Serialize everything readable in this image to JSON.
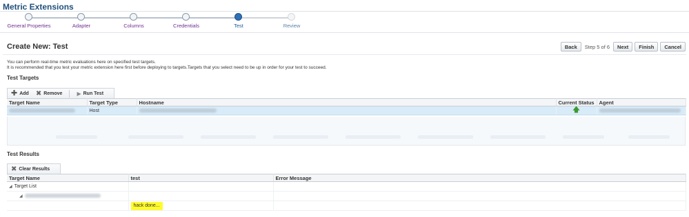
{
  "page": {
    "title": "Metric Extensions"
  },
  "train": {
    "steps": [
      {
        "label": "General Properties",
        "state": "visited"
      },
      {
        "label": "Adapter",
        "state": "visited"
      },
      {
        "label": "Columns",
        "state": "visited"
      },
      {
        "label": "Credentials",
        "state": "visited"
      },
      {
        "label": "Test",
        "state": "current"
      },
      {
        "label": "Review",
        "state": "future"
      }
    ]
  },
  "header": {
    "title": "Create New: Test",
    "back_label": "Back",
    "step_text": "Step 5 of 6",
    "next_label": "Next",
    "finish_label": "Finish",
    "cancel_label": "Cancel"
  },
  "info": {
    "line1": "You can perform real-time metric evaluations here on specified test targets.",
    "line2": "It is recommended that you test your metric extension here first before deploying to targets.Targets that you select need to be up in order for your test to succeed."
  },
  "targets": {
    "title": "Test Targets",
    "toolbar": {
      "add_label": "Add",
      "remove_label": "Remove",
      "run_label": "Run Test"
    },
    "columns": [
      "Target Name",
      "Target Type",
      "Hostname",
      "Current Status",
      "Agent"
    ],
    "rows": [
      {
        "target_type": "Host",
        "status_icon": "arrow-up-icon"
      }
    ]
  },
  "results": {
    "title": "Test Results",
    "toolbar": {
      "clear_label": "Clear Results"
    },
    "columns": [
      "Target Name",
      "test",
      "Error Message"
    ],
    "tree_root": "Target List",
    "result_value": "hack done..."
  },
  "colors": {
    "title": "#1f4f7b",
    "selected_row": "#d8ebf8",
    "highlight": "#fffb2e",
    "status_up": "#3a9a2e"
  }
}
